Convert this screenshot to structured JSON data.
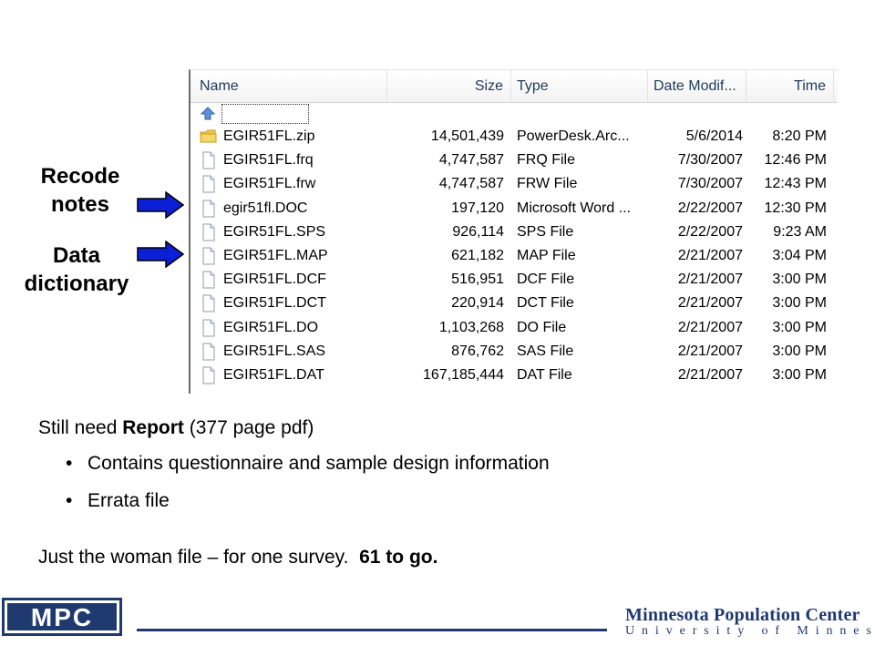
{
  "annotations": {
    "recode_line1": "Recode",
    "recode_line2": "notes",
    "data_dict_line1": "Data",
    "data_dict_line2": "dictionary"
  },
  "explorer": {
    "columns": {
      "name": "Name",
      "size": "Size",
      "type": "Type",
      "date": "Date Modif...",
      "time": "Time"
    },
    "files": [
      {
        "name": "EGIR51FL.zip",
        "size": "14,501,439",
        "type": "PowerDesk.Arc...",
        "date": "5/6/2014",
        "time": "8:20 PM",
        "icon": "folder-zip"
      },
      {
        "name": "EGIR51FL.frq",
        "size": "4,747,587",
        "type": "FRQ File",
        "date": "7/30/2007",
        "time": "12:46 PM",
        "icon": "file"
      },
      {
        "name": "EGIR51FL.frw",
        "size": "4,747,587",
        "type": "FRW File",
        "date": "7/30/2007",
        "time": "12:43 PM",
        "icon": "file"
      },
      {
        "name": "egir51fl.DOC",
        "size": "197,120",
        "type": "Microsoft Word ...",
        "date": "2/22/2007",
        "time": "12:30 PM",
        "icon": "file"
      },
      {
        "name": "EGIR51FL.SPS",
        "size": "926,114",
        "type": "SPS File",
        "date": "2/22/2007",
        "time": "9:23 AM",
        "icon": "file"
      },
      {
        "name": "EGIR51FL.MAP",
        "size": "621,182",
        "type": "MAP File",
        "date": "2/21/2007",
        "time": "3:04 PM",
        "icon": "file"
      },
      {
        "name": "EGIR51FL.DCF",
        "size": "516,951",
        "type": "DCF File",
        "date": "2/21/2007",
        "time": "3:00 PM",
        "icon": "file"
      },
      {
        "name": "EGIR51FL.DCT",
        "size": "220,914",
        "type": "DCT File",
        "date": "2/21/2007",
        "time": "3:00 PM",
        "icon": "file"
      },
      {
        "name": "EGIR51FL.DO",
        "size": "1,103,268",
        "type": "DO File",
        "date": "2/21/2007",
        "time": "3:00 PM",
        "icon": "file"
      },
      {
        "name": "EGIR51FL.SAS",
        "size": "876,762",
        "type": "SAS File",
        "date": "2/21/2007",
        "time": "3:00 PM",
        "icon": "file"
      },
      {
        "name": "EGIR51FL.DAT",
        "size": "167,185,444",
        "type": "DAT File",
        "date": "2/21/2007",
        "time": "3:00 PM",
        "icon": "file"
      }
    ]
  },
  "text": {
    "still_need_prefix": "Still need ",
    "still_need_bold": "Report",
    "still_need_suffix": " (377 page pdf)",
    "bullet_char": "•",
    "bullet1": "Contains questionnaire and sample design information",
    "bullet2": "Errata file",
    "just_woman": "Just the woman file – for one survey.  ",
    "just_woman_bold": "61 to go."
  },
  "footer": {
    "logo_text": "MPC",
    "center_name": "Minnesota Population Center",
    "university": "University of Minnesota"
  },
  "colors": {
    "arrow": "#0a1fd6",
    "brand": "#1f3a70",
    "header_text": "#1e395b"
  }
}
